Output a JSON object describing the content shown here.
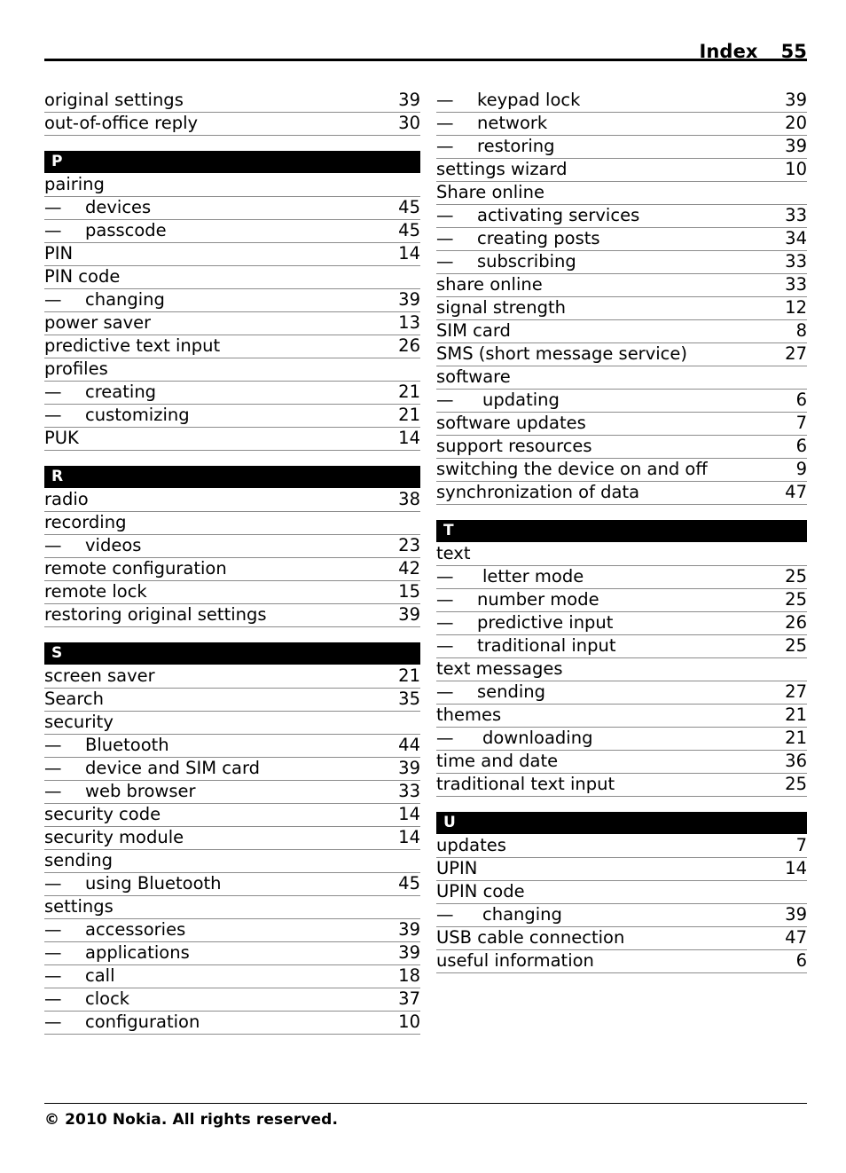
{
  "header": {
    "title": "Index",
    "page_number": "55"
  },
  "footer": {
    "copyright": "© 2010 Nokia. All rights reserved."
  },
  "symbols": {
    "em_dash": "—"
  },
  "columns": {
    "left": [
      {
        "kind": "entry",
        "label": "original settings",
        "page": "39"
      },
      {
        "kind": "entry",
        "label": "out-of-office reply",
        "page": "30"
      },
      {
        "kind": "section",
        "letter": "P"
      },
      {
        "kind": "entry",
        "label": "pairing",
        "page": ""
      },
      {
        "kind": "sub",
        "label": "devices",
        "page": "45"
      },
      {
        "kind": "sub",
        "label": "passcode",
        "page": "45"
      },
      {
        "kind": "entry",
        "label": "PIN",
        "page": "14"
      },
      {
        "kind": "entry",
        "label": "PIN code",
        "page": ""
      },
      {
        "kind": "sub",
        "label": "changing",
        "page": "39"
      },
      {
        "kind": "entry",
        "label": "power saver",
        "page": "13"
      },
      {
        "kind": "entry",
        "label": "predictive text input",
        "page": "26"
      },
      {
        "kind": "entry",
        "label": "profiles",
        "page": ""
      },
      {
        "kind": "sub",
        "label": "creating",
        "page": "21"
      },
      {
        "kind": "sub",
        "label": "customizing",
        "page": "21"
      },
      {
        "kind": "entry",
        "label": "PUK",
        "page": "14"
      },
      {
        "kind": "section",
        "letter": "R"
      },
      {
        "kind": "entry",
        "label": "radio",
        "page": "38"
      },
      {
        "kind": "entry",
        "label": "recording",
        "page": ""
      },
      {
        "kind": "sub",
        "label": "videos",
        "page": "23"
      },
      {
        "kind": "entry",
        "label": "remote configuration",
        "page": "42"
      },
      {
        "kind": "entry",
        "label": "remote lock",
        "page": "15"
      },
      {
        "kind": "entry",
        "label": "restoring original settings",
        "page": "39"
      },
      {
        "kind": "section",
        "letter": "S"
      },
      {
        "kind": "entry",
        "label": "screen saver",
        "page": "21"
      },
      {
        "kind": "entry",
        "label": "Search",
        "page": "35"
      },
      {
        "kind": "entry",
        "label": "security",
        "page": ""
      },
      {
        "kind": "sub",
        "label": "Bluetooth",
        "page": "44"
      },
      {
        "kind": "sub",
        "label": "device and SIM card",
        "page": "39"
      },
      {
        "kind": "sub",
        "label": "web browser",
        "page": "33"
      },
      {
        "kind": "entry",
        "label": "security code",
        "page": "14"
      },
      {
        "kind": "entry",
        "label": "security module",
        "page": "14"
      },
      {
        "kind": "entry",
        "label": "sending",
        "page": ""
      },
      {
        "kind": "sub",
        "label": "using Bluetooth",
        "page": "45"
      },
      {
        "kind": "entry",
        "label": "settings",
        "page": ""
      },
      {
        "kind": "sub",
        "label": "accessories",
        "page": "39"
      },
      {
        "kind": "sub",
        "label": "applications",
        "page": "39"
      },
      {
        "kind": "sub",
        "label": "call",
        "page": "18"
      },
      {
        "kind": "sub",
        "label": "clock",
        "page": "37"
      },
      {
        "kind": "sub",
        "label": "configuration",
        "page": "10"
      }
    ],
    "right": [
      {
        "kind": "sub",
        "label": "keypad lock",
        "page": "39"
      },
      {
        "kind": "sub",
        "label": "network",
        "page": "20"
      },
      {
        "kind": "sub",
        "label": "restoring",
        "page": "39"
      },
      {
        "kind": "entry",
        "label": "settings wizard",
        "page": "10"
      },
      {
        "kind": "entry",
        "label": "Share online",
        "page": ""
      },
      {
        "kind": "sub",
        "label": "activating services",
        "page": "33"
      },
      {
        "kind": "sub",
        "label": "creating posts",
        "page": "34"
      },
      {
        "kind": "sub",
        "label": "subscribing",
        "page": "33"
      },
      {
        "kind": "entry",
        "label": "share online",
        "page": "33"
      },
      {
        "kind": "entry",
        "label": "signal strength",
        "page": "12"
      },
      {
        "kind": "entry",
        "label": "SIM card",
        "page": "8"
      },
      {
        "kind": "entry",
        "label": "SMS (short message service)",
        "page": "27"
      },
      {
        "kind": "entry",
        "label": "software",
        "page": ""
      },
      {
        "kind": "sub",
        "label": "updating",
        "page": "6",
        "wide": true
      },
      {
        "kind": "entry",
        "label": "software updates",
        "page": "7"
      },
      {
        "kind": "entry",
        "label": "support resources",
        "page": "6"
      },
      {
        "kind": "entry",
        "label": "switching the device on and off",
        "page": "9"
      },
      {
        "kind": "entry",
        "label": "synchronization of data",
        "page": "47"
      },
      {
        "kind": "section",
        "letter": "T"
      },
      {
        "kind": "entry",
        "label": "text",
        "page": ""
      },
      {
        "kind": "sub",
        "label": "letter mode",
        "page": "25",
        "wide": true
      },
      {
        "kind": "sub",
        "label": "number mode",
        "page": "25"
      },
      {
        "kind": "sub",
        "label": "predictive input",
        "page": "26"
      },
      {
        "kind": "sub",
        "label": "traditional input",
        "page": "25"
      },
      {
        "kind": "entry",
        "label": "text messages",
        "page": ""
      },
      {
        "kind": "sub",
        "label": "sending",
        "page": "27"
      },
      {
        "kind": "entry",
        "label": "themes",
        "page": "21"
      },
      {
        "kind": "sub",
        "label": "downloading",
        "page": "21",
        "wide": true
      },
      {
        "kind": "entry",
        "label": "time and date",
        "page": "36"
      },
      {
        "kind": "entry",
        "label": "traditional text input",
        "page": "25"
      },
      {
        "kind": "section",
        "letter": "U"
      },
      {
        "kind": "entry",
        "label": "updates",
        "page": "7"
      },
      {
        "kind": "entry",
        "label": "UPIN",
        "page": "14"
      },
      {
        "kind": "entry",
        "label": "UPIN code",
        "page": ""
      },
      {
        "kind": "sub",
        "label": "changing",
        "page": "39",
        "wide": true
      },
      {
        "kind": "entry",
        "label": "USB cable connection",
        "page": "47"
      },
      {
        "kind": "entry",
        "label": "useful information",
        "page": "6"
      }
    ]
  }
}
